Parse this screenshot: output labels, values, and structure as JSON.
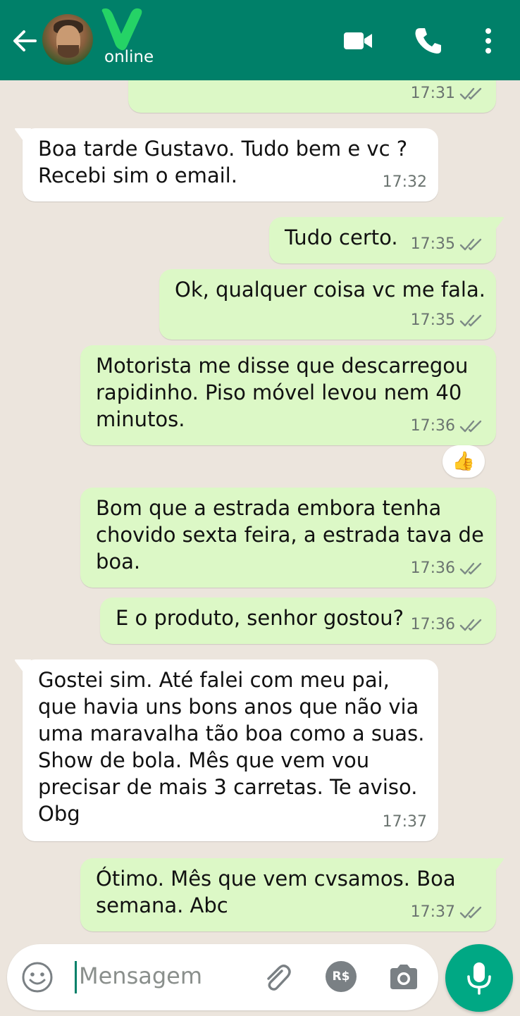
{
  "header": {
    "status": "online",
    "colors": {
      "bar": "#008069",
      "accent": "#25d366"
    },
    "icons": [
      "back-arrow-icon",
      "avatar",
      "contact-logo",
      "video-call-icon",
      "phone-call-icon",
      "more-menu-icon"
    ]
  },
  "messages": [
    {
      "dir": "out",
      "text": "",
      "time": "17:31",
      "ticks": true
    },
    {
      "dir": "in",
      "text": "Boa tarde Gustavo. Tudo bem e vc ?\nRecebi sim o email.",
      "time": "17:32",
      "ticks": false
    },
    {
      "dir": "out",
      "text": "Tudo certo.",
      "time": "17:35",
      "ticks": true
    },
    {
      "dir": "out",
      "text": "Ok, qualquer coisa vc me fala.",
      "time": "17:35",
      "ticks": true
    },
    {
      "dir": "out",
      "text": "Motorista me disse que descarregou\nrapidinho. Piso móvel levou nem 40\nminutos.",
      "time": "17:36",
      "ticks": true,
      "reaction": "👍"
    },
    {
      "dir": "out",
      "text": "Bom que a estrada embora tenha\nchovido sexta feira, a estrada tava de\nboa.",
      "time": "17:36",
      "ticks": true
    },
    {
      "dir": "out",
      "text": "E o produto, senhor gostou?",
      "time": "17:36",
      "ticks": true
    },
    {
      "dir": "in",
      "text": "Gostei sim. Até falei com meu pai,\nque havia uns bons anos que não via\numa maravalha tão boa como a suas.\nShow de bola. Mês que vem vou\nprecisar de mais 3 carretas. Te aviso.\nObg",
      "time": "17:37",
      "ticks": false
    },
    {
      "dir": "out",
      "text": "Ótimo. Mês que vem cvsamos. Boa\nsemana. Abc",
      "time": "17:37",
      "ticks": true
    }
  ],
  "composer": {
    "placeholder": "Mensagem",
    "pay_label": "R$",
    "icons": [
      "emoji-icon",
      "attach-icon",
      "payment-icon",
      "camera-icon",
      "mic-icon"
    ]
  }
}
